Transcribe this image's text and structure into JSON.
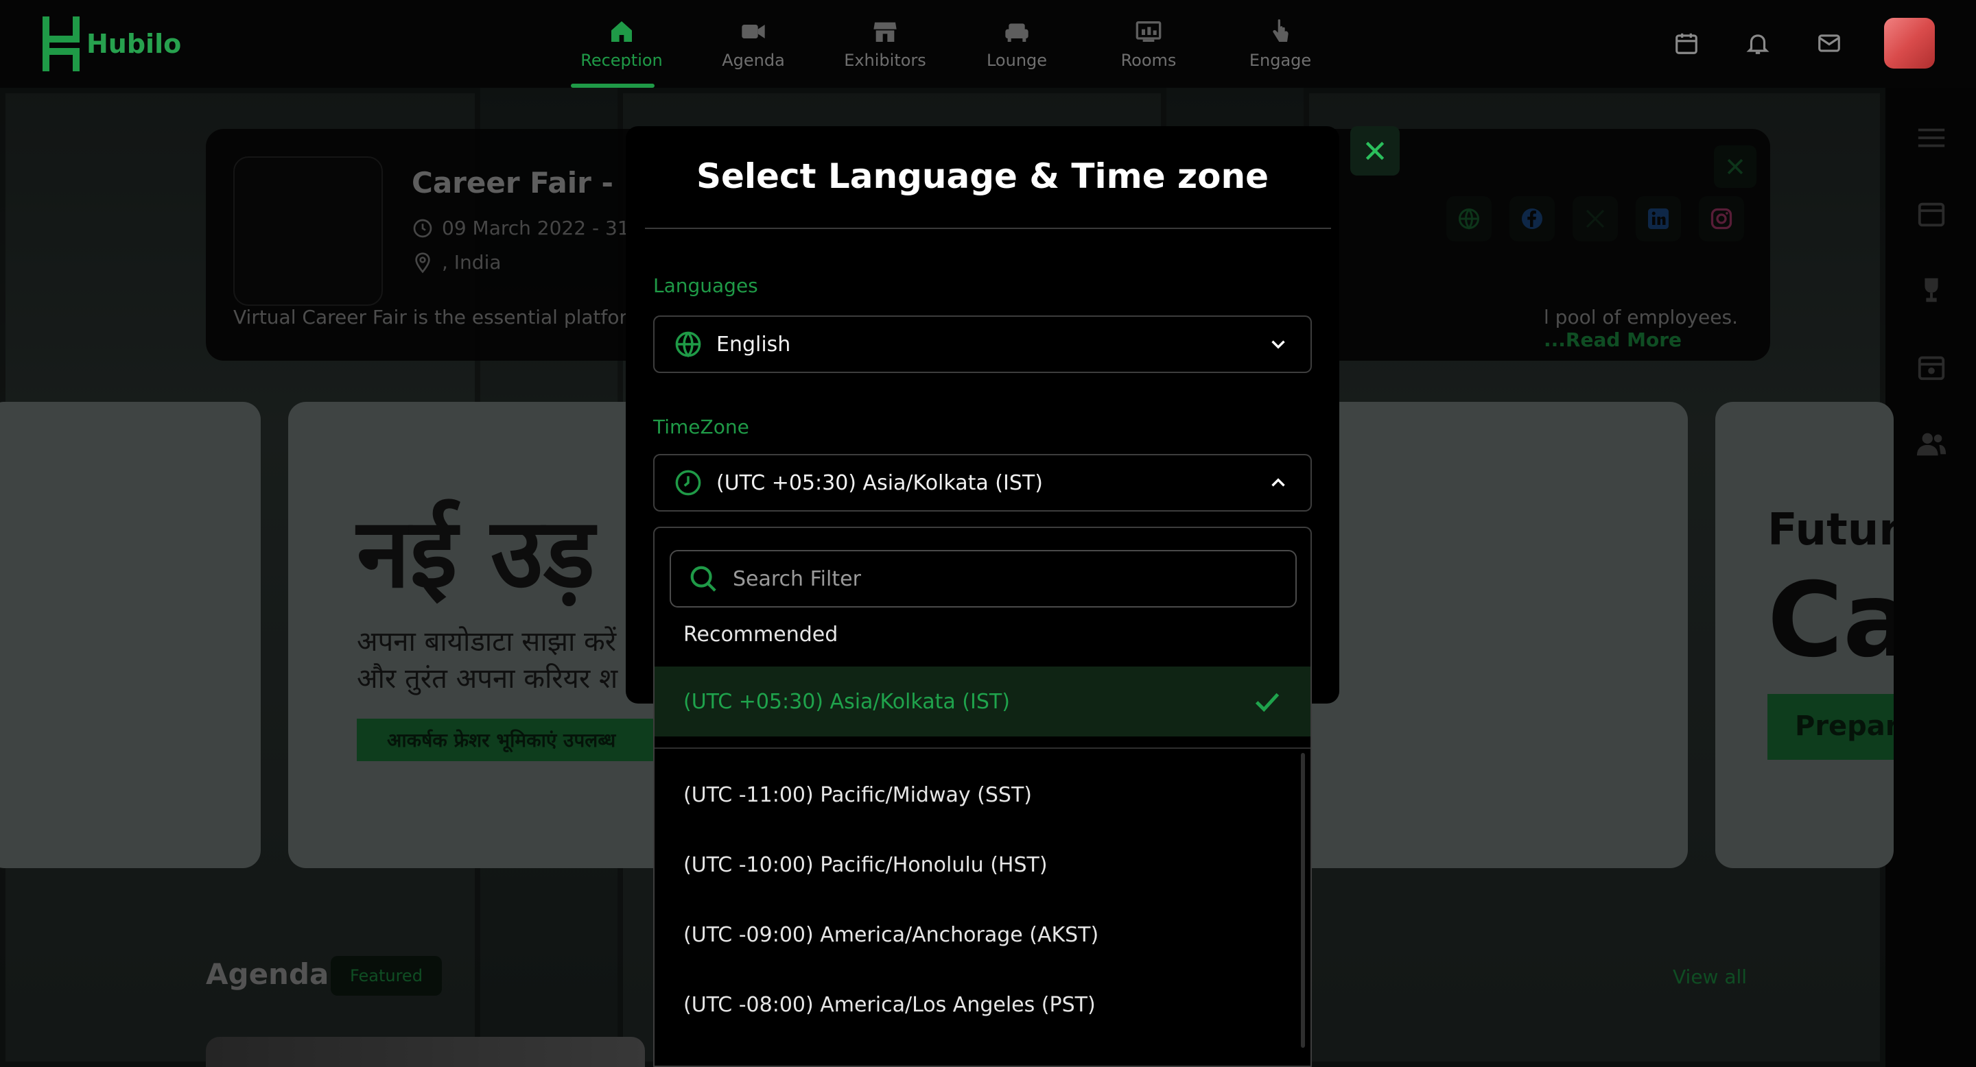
{
  "app": {
    "brand": "Hubilo"
  },
  "nav": {
    "tabs": [
      {
        "label": "Reception",
        "icon": "home-icon",
        "active": true
      },
      {
        "label": "Agenda",
        "icon": "video-icon",
        "active": false
      },
      {
        "label": "Exhibitors",
        "icon": "store-icon",
        "active": false
      },
      {
        "label": "Lounge",
        "icon": "sofa-icon",
        "active": false
      },
      {
        "label": "Rooms",
        "icon": "screen-icon",
        "active": false
      },
      {
        "label": "Engage",
        "icon": "touch-icon",
        "active": false
      }
    ],
    "right_icons": [
      "calendar-icon",
      "bell-icon",
      "mail-icon"
    ]
  },
  "event": {
    "title": "Career Fair - MI",
    "date": "09 March 2022 - 31",
    "location": ", India",
    "description_start": "Virtual Career Fair is the essential platforr",
    "description_end": "l pool of employees.",
    "read_more": "...Read More"
  },
  "banners": {
    "hindi_big": "नई उड़",
    "hindi_line1": "अपना बायोडाटा साझा करें",
    "hindi_line2": "और तुरंत अपना करियर श",
    "hindi_button": "आकर्षक फ्रेशर भूमिकाएं उपलब्ध",
    "future_1": "Futur",
    "future_2": "Ca",
    "future_button": "Prepar"
  },
  "agenda": {
    "title": "Agenda",
    "badge": "Featured",
    "view_all": "View all"
  },
  "modal": {
    "title": "Select Language & Time zone",
    "language_label": "Languages",
    "language_value": "English",
    "timezone_label": "TimeZone",
    "timezone_value": "(UTC +05:30) Asia/Kolkata (IST)",
    "search_placeholder": "Search Filter",
    "recommended_label": "Recommended",
    "selected_option": "(UTC +05:30) Asia/Kolkata (IST)",
    "options": [
      "(UTC -11:00) Pacific/Midway (SST)",
      "(UTC -10:00) Pacific/Honolulu (HST)",
      "(UTC -09:00) America/Anchorage (AKST)",
      "(UTC -08:00) America/Los Angeles (PST)"
    ]
  },
  "colors": {
    "accent": "#1f9a47",
    "background": "#050505"
  }
}
